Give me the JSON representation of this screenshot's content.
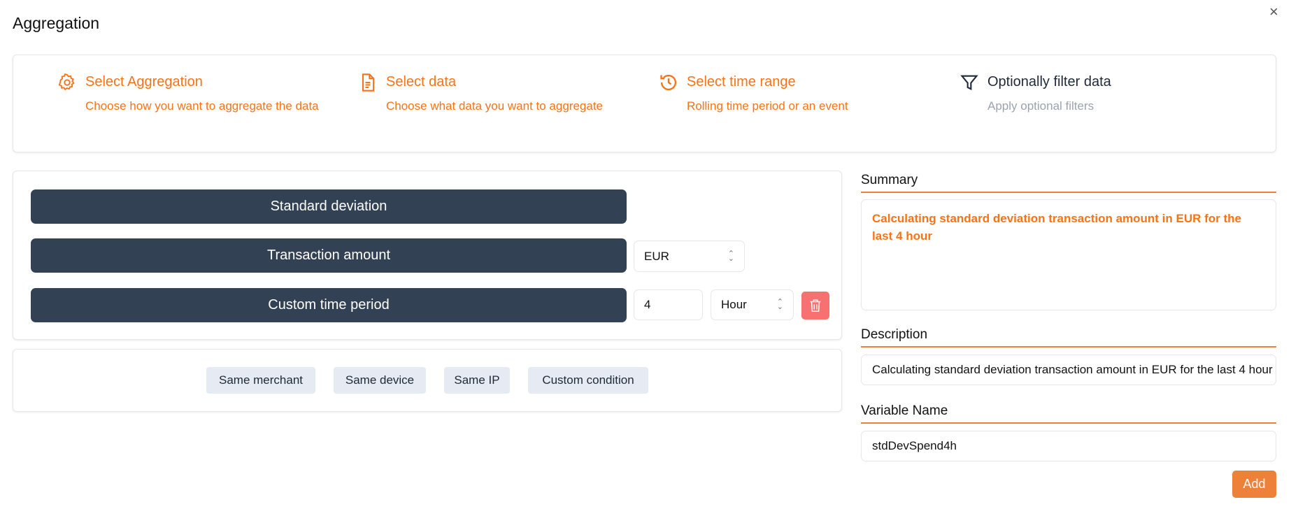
{
  "dialog": {
    "title": "Aggregation",
    "close_label": "×"
  },
  "steps": [
    {
      "title": "Select Aggregation",
      "subtitle": "Choose how you want to aggregate the data",
      "icon": "gear-icon",
      "active": true
    },
    {
      "title": "Select data",
      "subtitle": "Choose what data you want to aggregate",
      "icon": "document-icon",
      "active": true
    },
    {
      "title": "Select time range",
      "subtitle": "Rolling time period or an event",
      "icon": "history-icon",
      "active": true
    },
    {
      "title": "Optionally filter data",
      "subtitle": "Apply optional filters",
      "icon": "filter-icon",
      "active": false
    }
  ],
  "config": {
    "aggregation": "Standard deviation",
    "data": "Transaction amount",
    "currency": "EUR",
    "time_period": "Custom time period",
    "time_value": "4",
    "time_unit": "Hour"
  },
  "conditions": [
    "Same merchant",
    "Same device",
    "Same IP",
    "Custom condition"
  ],
  "summary": {
    "label": "Summary",
    "text": "Calculating standard deviation transaction amount in EUR for the last 4 hour"
  },
  "description": {
    "label": "Description",
    "value": "Calculating standard deviation transaction amount in EUR for the last 4 hour"
  },
  "variable": {
    "label": "Variable Name",
    "value": "stdDevSpend4h"
  },
  "add_label": "Add",
  "colors": {
    "accent": "#f97316",
    "button": "#334155",
    "add": "#ed8139",
    "delete": "#f87171"
  }
}
